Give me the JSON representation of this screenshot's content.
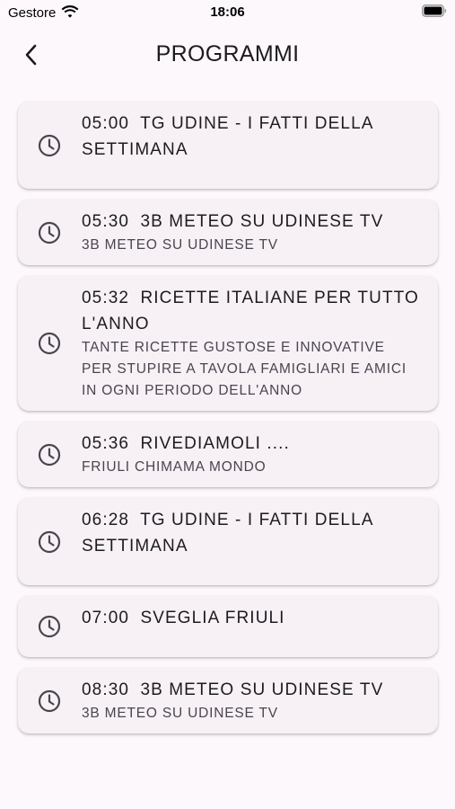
{
  "status_bar": {
    "carrier": "Gestore",
    "time": "18:06"
  },
  "header": {
    "title": "PROGRAMMI"
  },
  "programs": [
    {
      "time": "05:00",
      "title": "TG UDINE - I FATTI DELLA SETTIMANA",
      "description": ""
    },
    {
      "time": "05:30",
      "title": "3B METEO SU UDINESE TV",
      "description": "3B METEO SU UDINESE TV"
    },
    {
      "time": "05:32",
      "title": "RICETTE ITALIANE PER TUTTO L'ANNO",
      "description": "TANTE RICETTE GUSTOSE E INNOVATIVE PER STUPIRE A TAVOLA FAMIGLIARI E AMICI IN OGNI PERIODO DELL'ANNO"
    },
    {
      "time": "05:36",
      "title": "RIVEDIAMOLI ....",
      "description": "FRIULI CHIMAMA MONDO"
    },
    {
      "time": "06:28",
      "title": "TG UDINE - I FATTI DELLA SETTIMANA",
      "description": ""
    },
    {
      "time": "07:00",
      "title": "SVEGLIA FRIULI",
      "description": ""
    },
    {
      "time": "08:30",
      "title": "3B METEO SU UDINESE TV",
      "description": "3B METEO SU UDINESE TV"
    }
  ],
  "icons": {
    "back": "chevron-left-icon",
    "program": "clock-icon",
    "wifi": "wifi-icon",
    "battery": "battery-icon"
  },
  "colors": {
    "background": "#fdf8fb",
    "card": "#f7f1f6",
    "text": "#1d1b20",
    "secondary_text": "#49454f"
  }
}
